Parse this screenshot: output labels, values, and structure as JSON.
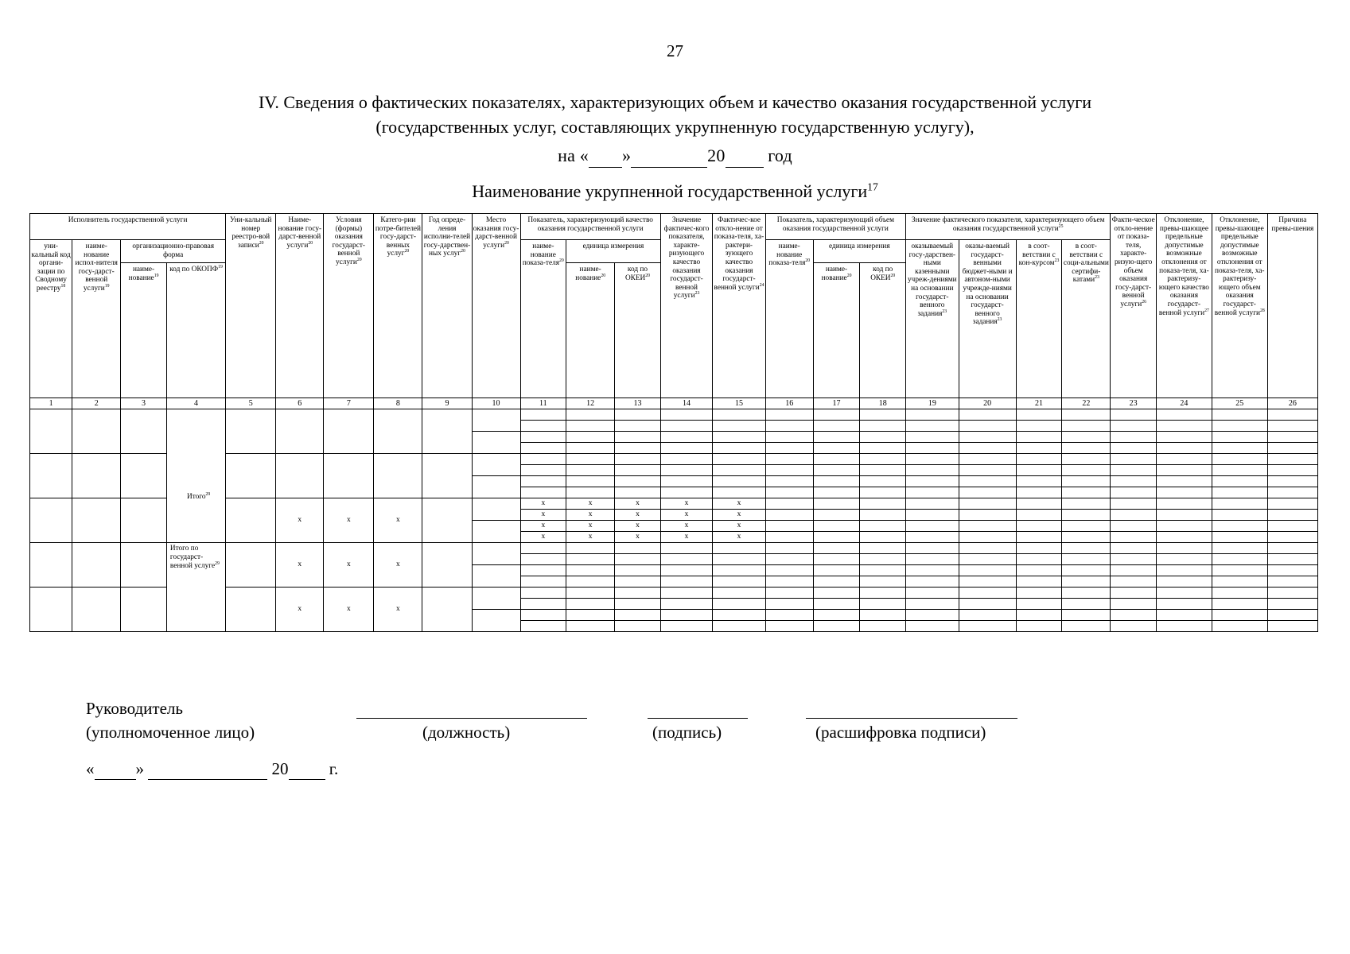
{
  "page": {
    "number": "27"
  },
  "title": {
    "line1": "IV. Сведения о фактических показателях, характеризующих объем и качество оказания государственной услуги",
    "line2": "(государственных услуг, составляющих укрупненную государственную услугу),",
    "line3_prefix": "на «",
    "line3_mid": "»",
    "line3_year": "20",
    "line3_suffix": "год"
  },
  "service_heading": {
    "text": "Наименование укрупненной государственной услуги",
    "footnote": "17"
  },
  "table": {
    "group_headers": {
      "performer": "Исполнитель государственной услуги",
      "legal_form": "организационно-правовая форма",
      "quality_indicator": "Показатель, характеризующий качество оказания государственной услуги",
      "unit_of_measure": "единица измерения",
      "volume_indicator": "Показатель, характеризующий объем оказания государственной услуги",
      "actual_value_group": "Значение фактического показателя, характеризующего объем оказания государственной услуги",
      "actual_value_group_footnote": "25"
    },
    "columns": [
      {
        "num": "1",
        "label": "уни-кальный код органи-зации по Сводному реестру",
        "footnote": "18"
      },
      {
        "num": "2",
        "label": "наиме-нование испол-нителя госу-дарст-венной услуги",
        "footnote": "19"
      },
      {
        "num": "3",
        "label": "наиме-нование",
        "footnote": "19"
      },
      {
        "num": "4",
        "label": "код по ОКОПФ",
        "footnote": "19"
      },
      {
        "num": "5",
        "label": "Уни-кальный номер реестро-вой записи",
        "footnote": "20"
      },
      {
        "num": "6",
        "label": "Наиме-нование госу-дарст-венной услуги",
        "footnote": "20"
      },
      {
        "num": "7",
        "label": "Условия (формы) оказания государст-венной услуги",
        "footnote": "20"
      },
      {
        "num": "8",
        "label": "Катего-рии потре-бителей госу-дарст-венных услуг",
        "footnote": "20"
      },
      {
        "num": "9",
        "label": "Год опреде-ления исполни-телей госу-дарствен-ных услуг",
        "footnote": "20"
      },
      {
        "num": "10",
        "label": "Место оказания госу-дарст-венной услуги",
        "footnote": "20"
      },
      {
        "num": "11",
        "label": "наиме-нование показа-теля",
        "footnote": "20"
      },
      {
        "num": "12",
        "label": "наиме-нование",
        "footnote": "20"
      },
      {
        "num": "13",
        "label": "код по ОКЕИ",
        "footnote": "20"
      },
      {
        "num": "14",
        "label": "Значение фактичес-кого показателя, характе-ризующего качество оказания государст-венной услуги",
        "footnote": "23"
      },
      {
        "num": "15",
        "label": "Фактичес-кое откло-нение от показа-теля, ха-рактери-зующего качество оказания государст-венной услуги",
        "footnote": "24"
      },
      {
        "num": "16",
        "label": "наиме-нование показа-теля",
        "footnote": "20"
      },
      {
        "num": "17",
        "label": "наиме-нование",
        "footnote": "20"
      },
      {
        "num": "18",
        "label": "код по ОКЕИ",
        "footnote": "20"
      },
      {
        "num": "19",
        "label": "оказываемый госу-дарствен-ными казенными учреж-дениями на основании государст-венного задания",
        "footnote": "23"
      },
      {
        "num": "20",
        "label": "оказы-ваемый государст-венными бюджет-ными и автоном-ными учрежде-ниями на основании государст-венного задания",
        "footnote": "23"
      },
      {
        "num": "21",
        "label": "в соот-ветствии с кон-курсом",
        "footnote": "23"
      },
      {
        "num": "22",
        "label": "в соот-ветствии с соци-альными сертифи-катами",
        "footnote": "23"
      },
      {
        "num": "23",
        "label": "Факти-ческое откло-нение от показа-теля, характе-ризую-щего объем оказания госу-дарст-венной услуги",
        "footnote": "26"
      },
      {
        "num": "24",
        "label": "Отклонение, превы-шающее предельные допустимые возможные отклонения от показа-теля, ха-рактеризу-ющего качество оказания государст-венной услуги",
        "footnote": "27"
      },
      {
        "num": "25",
        "label": "Отклонение, превы-шающее предельные допустимые возможные отклонения от показа-теля, ха-рактеризу-ющего объем оказания государст-венной услуги",
        "footnote": "28"
      },
      {
        "num": "26",
        "label": "Причина превы-шения",
        "footnote": ""
      }
    ],
    "totals": {
      "itogo": "Итого",
      "itogo_footnote": "29",
      "itogo_service": "Итого по государст-венной услуге",
      "itogo_service_footnote": "29"
    },
    "x_mark": "х"
  },
  "signature": {
    "leader": "Руководитель",
    "authorized": "(уполномоченное лицо)",
    "position": "(должность)",
    "sign": "(подпись)",
    "transcript": "(расшифровка подписи)",
    "date_open": "«",
    "date_close": "»",
    "date_year": "20",
    "date_suffix": "г."
  }
}
